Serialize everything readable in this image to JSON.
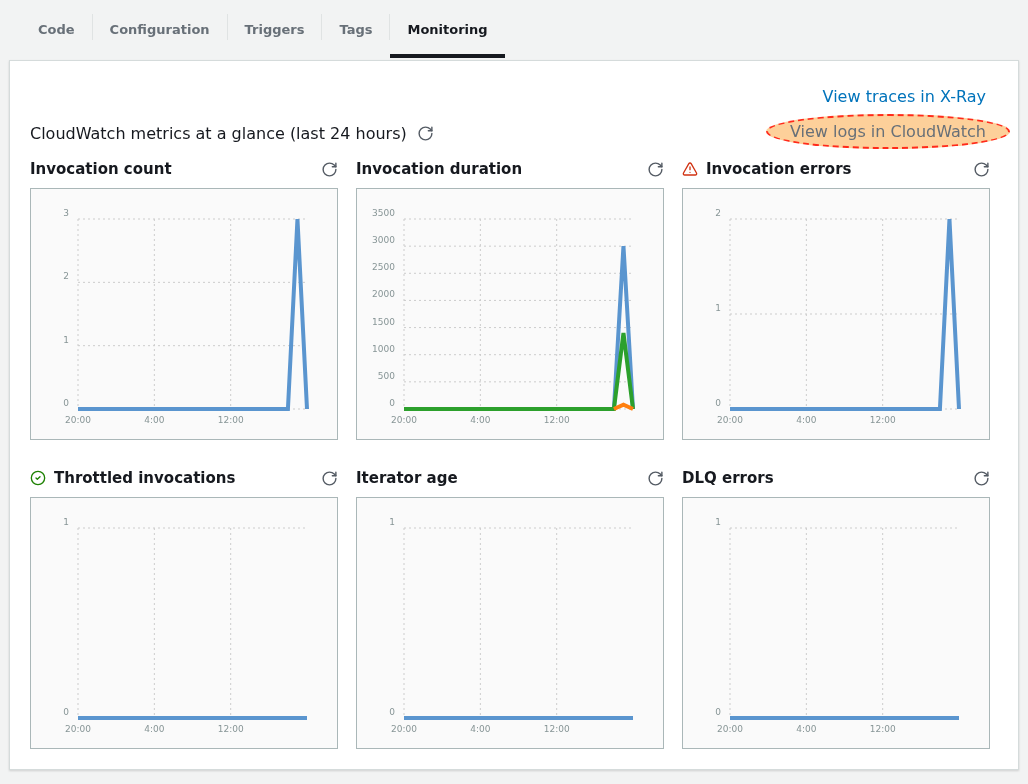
{
  "tabs": [
    {
      "label": "Code",
      "selected": false
    },
    {
      "label": "Configuration",
      "selected": false
    },
    {
      "label": "Triggers",
      "selected": false
    },
    {
      "label": "Tags",
      "selected": false
    },
    {
      "label": "Monitoring",
      "selected": true
    }
  ],
  "header": {
    "title": "CloudWatch metrics at a glance (last 24 hours)",
    "links": [
      {
        "label": "View traces in X-Ray",
        "highlighted": false
      },
      {
        "label": "View logs in CloudWatch",
        "highlighted": true
      }
    ]
  },
  "metrics": [
    {
      "title": "Invocation count",
      "warning": false,
      "healthy": false,
      "chart_data": {
        "type": "line",
        "categories": [
          "20:00",
          null,
          null,
          null,
          null,
          null,
          null,
          null,
          "4:00",
          null,
          null,
          null,
          null,
          null,
          null,
          null,
          "12:00",
          null,
          null,
          null,
          null,
          null,
          null,
          null,
          null
        ],
        "ylim": [
          0,
          3
        ],
        "yticks": [
          0,
          1,
          2,
          3
        ],
        "series": [
          {
            "color": "#5a95cf",
            "values": [
              0,
              0,
              0,
              0,
              0,
              0,
              0,
              0,
              0,
              0,
              0,
              0,
              0,
              0,
              0,
              0,
              0,
              0,
              0,
              0,
              0,
              0,
              0,
              3,
              0
            ]
          }
        ],
        "grid": true
      }
    },
    {
      "title": "Invocation duration",
      "warning": false,
      "healthy": false,
      "chart_data": {
        "type": "line",
        "categories": [
          "20:00",
          null,
          null,
          null,
          null,
          null,
          null,
          null,
          "4:00",
          null,
          null,
          null,
          null,
          null,
          null,
          null,
          "12:00",
          null,
          null,
          null,
          null,
          null,
          null,
          null,
          null
        ],
        "ylim": [
          0,
          3500
        ],
        "yticks": [
          0,
          500,
          1000,
          1500,
          2000,
          2500,
          3000,
          3500
        ],
        "series": [
          {
            "color": "#5a95cf",
            "values": [
              null,
              null,
              null,
              null,
              null,
              null,
              null,
              null,
              null,
              null,
              null,
              null,
              null,
              null,
              null,
              null,
              null,
              null,
              null,
              null,
              null,
              null,
              0,
              3000,
              0
            ]
          },
          {
            "color": "#2ca02c",
            "values": [
              0,
              0,
              0,
              0,
              0,
              0,
              0,
              0,
              0,
              0,
              0,
              0,
              0,
              0,
              0,
              0,
              0,
              0,
              0,
              0,
              0,
              0,
              0,
              1400,
              0
            ]
          },
          {
            "color": "#ff7f0e",
            "values": [
              null,
              null,
              null,
              null,
              null,
              null,
              null,
              null,
              null,
              null,
              null,
              null,
              null,
              null,
              null,
              null,
              null,
              null,
              null,
              null,
              null,
              null,
              0,
              80,
              0
            ]
          }
        ],
        "grid": true
      }
    },
    {
      "title": "Invocation errors",
      "warning": true,
      "healthy": false,
      "chart_data": {
        "type": "line",
        "categories": [
          "20:00",
          null,
          null,
          null,
          null,
          null,
          null,
          null,
          "4:00",
          null,
          null,
          null,
          null,
          null,
          null,
          null,
          "12:00",
          null,
          null,
          null,
          null,
          null,
          null,
          null,
          null
        ],
        "ylim": [
          0,
          2
        ],
        "yticks": [
          0,
          1,
          2
        ],
        "series": [
          {
            "color": "#5a95cf",
            "values": [
              0,
              0,
              0,
              0,
              0,
              0,
              0,
              0,
              0,
              0,
              0,
              0,
              0,
              0,
              0,
              0,
              0,
              0,
              0,
              0,
              0,
              0,
              0,
              2,
              0
            ]
          }
        ],
        "grid": true
      }
    },
    {
      "title": "Throttled invocations",
      "warning": false,
      "healthy": true,
      "chart_data": {
        "type": "line",
        "categories": [
          "20:00",
          null,
          null,
          null,
          null,
          null,
          null,
          null,
          "4:00",
          null,
          null,
          null,
          null,
          null,
          null,
          null,
          "12:00",
          null,
          null,
          null,
          null,
          null,
          null,
          null,
          null
        ],
        "ylim": [
          0,
          1
        ],
        "yticks": [
          0,
          1
        ],
        "series": [
          {
            "color": "#5a95cf",
            "values": [
              0,
              0,
              0,
              0,
              0,
              0,
              0,
              0,
              0,
              0,
              0,
              0,
              0,
              0,
              0,
              0,
              0,
              0,
              0,
              0,
              0,
              0,
              0,
              0,
              0
            ]
          }
        ],
        "grid": true
      }
    },
    {
      "title": "Iterator age",
      "warning": false,
      "healthy": false,
      "chart_data": {
        "type": "line",
        "categories": [
          "20:00",
          null,
          null,
          null,
          null,
          null,
          null,
          null,
          "4:00",
          null,
          null,
          null,
          null,
          null,
          null,
          null,
          "12:00",
          null,
          null,
          null,
          null,
          null,
          null,
          null,
          null
        ],
        "ylim": [
          0,
          1
        ],
        "yticks": [
          0,
          1
        ],
        "series": [
          {
            "color": "#5a95cf",
            "values": [
              0,
              0,
              0,
              0,
              0,
              0,
              0,
              0,
              0,
              0,
              0,
              0,
              0,
              0,
              0,
              0,
              0,
              0,
              0,
              0,
              0,
              0,
              0,
              0,
              0
            ]
          }
        ],
        "grid": true
      }
    },
    {
      "title": "DLQ errors",
      "warning": false,
      "healthy": false,
      "chart_data": {
        "type": "line",
        "categories": [
          "20:00",
          null,
          null,
          null,
          null,
          null,
          null,
          null,
          "4:00",
          null,
          null,
          null,
          null,
          null,
          null,
          null,
          "12:00",
          null,
          null,
          null,
          null,
          null,
          null,
          null,
          null
        ],
        "ylim": [
          0,
          1
        ],
        "yticks": [
          0,
          1
        ],
        "series": [
          {
            "color": "#5a95cf",
            "values": [
              0,
              0,
              0,
              0,
              0,
              0,
              0,
              0,
              0,
              0,
              0,
              0,
              0,
              0,
              0,
              0,
              0,
              0,
              0,
              0,
              0,
              0,
              0,
              0,
              0
            ]
          }
        ],
        "grid": true
      }
    }
  ]
}
